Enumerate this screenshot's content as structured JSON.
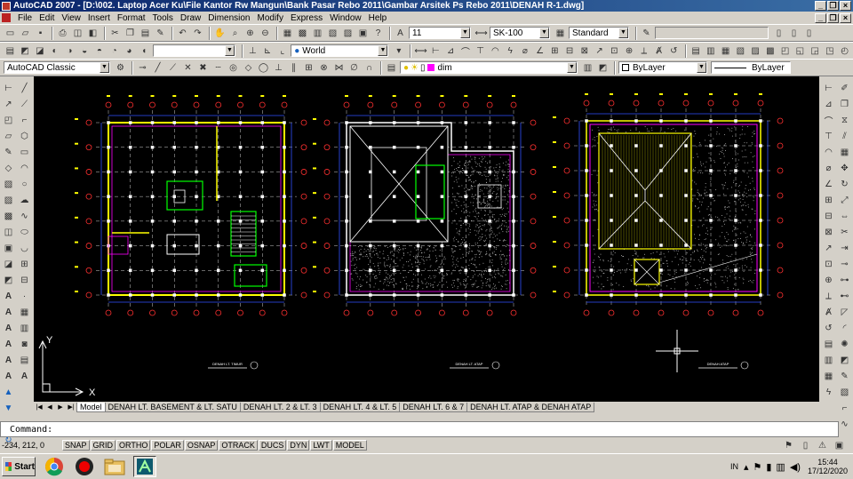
{
  "titlebar": {
    "title": "AutoCAD 2007 - [D:\\002. Laptop Acer Ku\\File Kantor Rw Mangun\\Bank Pasar Rebo 2011\\Gambar Arsitek Ps Rebo 2011\\DENAH R-1.dwg]",
    "minimize": "_",
    "restore": "❐",
    "close": "×"
  },
  "menubar": {
    "items": [
      "File",
      "Edit",
      "View",
      "Insert",
      "Format",
      "Tools",
      "Draw",
      "Dimension",
      "Modify",
      "Express",
      "Window",
      "Help"
    ]
  },
  "toolbar1": {
    "layer_value": "11",
    "dimstyle_value": "SK-100",
    "textstyle_value": "Standard"
  },
  "toolbar2": {
    "ucs_value": "World"
  },
  "toolbar3": {
    "workspace_value": "AutoCAD Classic",
    "layer_value": "dim",
    "color_value": "ByLayer",
    "linetype_value": "ByLayer"
  },
  "drawing": {
    "titles": [
      "DENAH LT. TIMUR",
      "DENAH LT. ATAP",
      "DENAH ATAP"
    ],
    "ucs_x": "X",
    "ucs_y": "Y"
  },
  "tabs": {
    "items": [
      "Model",
      "DENAH LT. BASEMENT & LT. SATU",
      "DENAH LT. 2 & LT. 3",
      "DENAH LT. 4 & LT. 5",
      "DENAH LT. 6 & 7",
      "DENAH LT. ATAP & DENAH ATAP"
    ],
    "active": "Model"
  },
  "command": {
    "prompt": "Command:",
    "value": ""
  },
  "statusbar": {
    "coords": "-234, 212, 0",
    "buttons": [
      "SNAP",
      "GRID",
      "ORTHO",
      "POLAR",
      "OSNAP",
      "OTRACK",
      "DUCS",
      "DYN",
      "LWT",
      "MODEL"
    ]
  },
  "taskbar": {
    "start_label": "Start",
    "lang": "IN",
    "time": "15:44",
    "date": "17/12/2020"
  },
  "colors": {
    "canvas": "#000000",
    "cad_yellow": "#ffff00",
    "cad_green": "#00ff00",
    "cad_blue": "#3050ff",
    "cad_magenta": "#ff00ff",
    "cad_red": "#ff3030",
    "cad_white": "#ffffff",
    "title_blue": "#0a246a"
  }
}
